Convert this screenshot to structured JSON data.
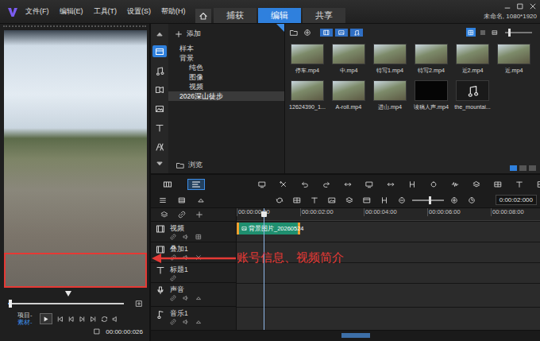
{
  "menu": [
    "文件(F)",
    "编辑(E)",
    "工具(T)",
    "设置(S)",
    "帮助(H)"
  ],
  "tabs": [
    {
      "label": "捕获",
      "selected": false
    },
    {
      "label": "编辑",
      "selected": true
    },
    {
      "label": "共享",
      "selected": false
    }
  ],
  "project_info": "未命名, 1080*1920",
  "preview": {
    "jog_level": 0.45,
    "scrub_level": 0.02,
    "modes": [
      {
        "label": "项目-",
        "selected": false
      },
      {
        "label": "素材-",
        "selected": true
      }
    ],
    "timecode": "00:00:00:026"
  },
  "library": {
    "categories": [
      {
        "kind": "media",
        "selected": true
      },
      {
        "kind": "audio",
        "selected": false
      },
      {
        "kind": "transition",
        "selected": false
      },
      {
        "kind": "image",
        "selected": false
      },
      {
        "kind": "title",
        "selected": false
      },
      {
        "kind": "fx",
        "selected": false
      }
    ],
    "add_label": "添加",
    "tree": [
      {
        "label": "样本",
        "selected": false
      },
      {
        "label": "背景",
        "selected": false,
        "expanded": true,
        "children": [
          {
            "label": "纯色",
            "selected": false
          },
          {
            "label": "图像",
            "selected": false
          },
          {
            "label": "视频",
            "selected": false
          }
        ]
      },
      {
        "label": "2026深山徒步",
        "selected": true
      }
    ],
    "browse_label": "浏览",
    "filters": [
      {
        "kind": "video",
        "selected": true
      },
      {
        "kind": "image",
        "selected": true
      },
      {
        "kind": "audio",
        "selected": true
      }
    ],
    "views": [
      {
        "kind": "thumbnails",
        "selected": true
      },
      {
        "kind": "list",
        "selected": false
      },
      {
        "kind": "details",
        "selected": false
      }
    ],
    "thumb_size_level": 0.15,
    "items": [
      {
        "name": "停车.mp4",
        "kind": "video"
      },
      {
        "name": "中.mp4",
        "kind": "video"
      },
      {
        "name": "特写1.mp4",
        "kind": "video"
      },
      {
        "name": "特写2.mp4",
        "kind": "video"
      },
      {
        "name": "近2.mp4",
        "kind": "video"
      },
      {
        "name": "近.mp4",
        "kind": "video"
      },
      {
        "name": "12624390_1...",
        "kind": "video"
      },
      {
        "name": "A-roll.mp4",
        "kind": "video"
      },
      {
        "name": "进山.mp4",
        "kind": "video"
      },
      {
        "name": "读稿人声.mp4",
        "kind": "blank"
      },
      {
        "name": "the_mountai...",
        "kind": "audio"
      }
    ]
  },
  "timeline": {
    "view_modes": [
      {
        "kind": "storyboard",
        "selected": false
      },
      {
        "kind": "timeline",
        "selected": true
      }
    ],
    "zoom_level": 0.55,
    "timecode": "0:00:02:000",
    "ruler": [
      "00:00:00:00",
      "00:00:02:00",
      "00:00:04:00",
      "00:00:06:00",
      "00:00:08:00"
    ],
    "ruler_step_seconds": 2,
    "playhead_seconds": 0.85,
    "tracks": [
      {
        "name": "视频",
        "kind": "video",
        "clips": [
          {
            "label": "背景图片_20260524",
            "start": 0,
            "end": 2,
            "selected": true
          }
        ]
      },
      {
        "name": "叠加1",
        "kind": "overlay",
        "clips": []
      },
      {
        "name": "标题1",
        "kind": "title",
        "clips": []
      },
      {
        "name": "声音",
        "kind": "voice",
        "clips": []
      },
      {
        "name": "音乐1",
        "kind": "music",
        "clips": []
      }
    ]
  },
  "annotation": {
    "text": "账号信息、视频简介"
  }
}
